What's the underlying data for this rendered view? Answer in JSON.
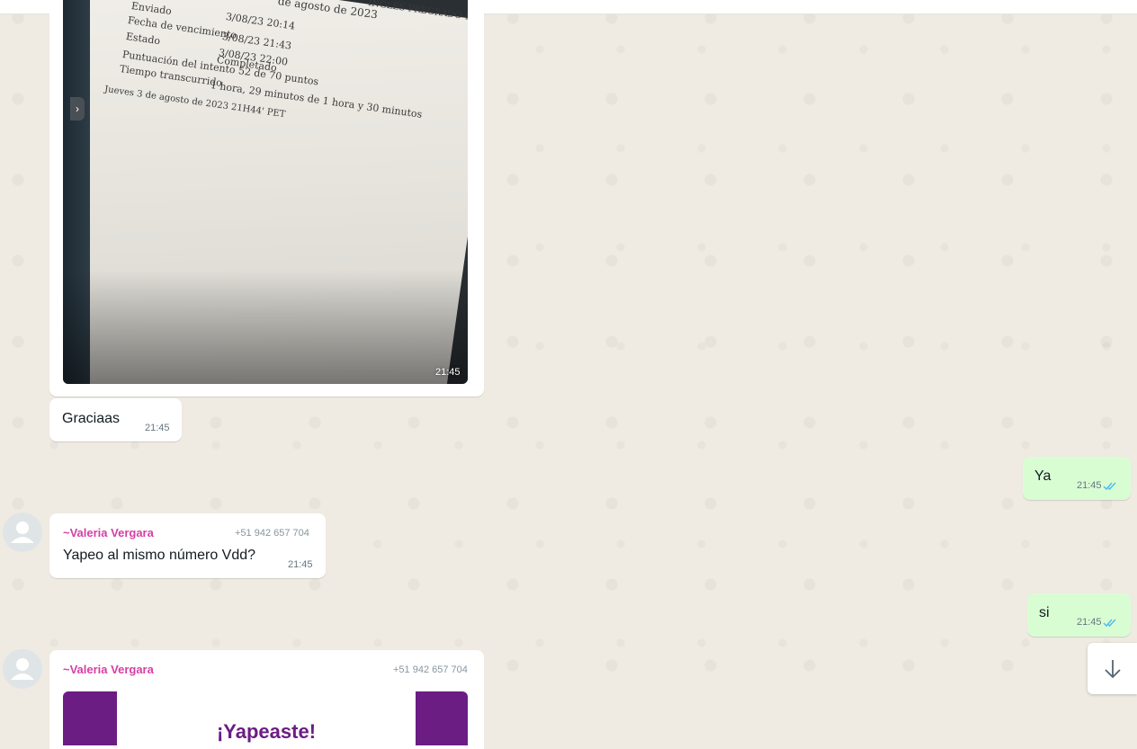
{
  "photo_message": {
    "time": "21:45",
    "screen_lines": [
      "de agosto de 2023",
      "INGLES PREGRADO-EPE",
      "Enviado",
      "3/08/23 20:14",
      "Fecha de vencimiento",
      "3/08/23 21:43",
      "3/08/23 22:00",
      "Estado",
      "Completado",
      "Puntuación del intento 52 de 70 puntos",
      "Tiempo transcurrido",
      "1 hora, 29 minutos de 1 hora y 30 minutos",
      "Jueves 3 de agosto de 2023 21H44' PET"
    ]
  },
  "messages": [
    {
      "text": "Graciaas",
      "time": "21:45"
    },
    {
      "text": "Ya",
      "time": "21:45"
    },
    {
      "sender": "~Valeria Vergara",
      "phone": "+51 942 657 704",
      "text": "Yapeo al mismo número Vdd?",
      "time": "21:45"
    },
    {
      "text": "si",
      "time": "21:45"
    },
    {
      "sender": "~Valeria Vergara",
      "phone": "+51 942 657 704",
      "card_title": "¡Yapeaste!"
    }
  ],
  "icons": {
    "read_receipt": "double-check-icon",
    "scroll_down": "arrow-down-icon",
    "avatar": "default-user-icon"
  },
  "colors": {
    "outgoing_bubble": "#d9fdd3",
    "incoming_bubble": "#ffffff",
    "sender_name": "#d63fa5",
    "read_tick": "#53bdeb",
    "yape_purple": "#6b1d84"
  }
}
